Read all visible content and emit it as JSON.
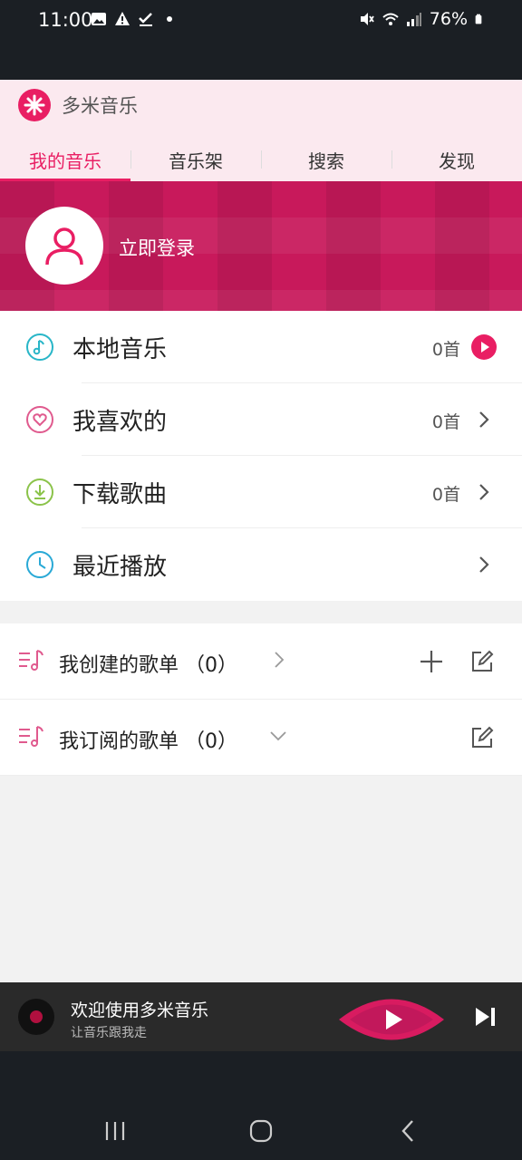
{
  "status": {
    "time": "11:00",
    "battery": "76%"
  },
  "app": {
    "name": "多米音乐"
  },
  "tabs": [
    "我的音乐",
    "音乐架",
    "搜索",
    "发现"
  ],
  "banner": {
    "login": "立即登录"
  },
  "my_music": [
    {
      "label": "本地音乐",
      "count": "0首",
      "action": "play-circle-icon"
    },
    {
      "label": "我喜欢的",
      "count": "0首",
      "action": "chevron-right-icon"
    },
    {
      "label": "下载歌曲",
      "count": "0首",
      "action": "chevron-right-icon"
    },
    {
      "label": "最近播放",
      "count": "",
      "action": "chevron-right-icon"
    }
  ],
  "playlists": [
    {
      "label": "我创建的歌单 （0）"
    },
    {
      "label": "我订阅的歌单 （0）"
    }
  ],
  "player": {
    "title": "欢迎使用多米音乐",
    "subtitle": "让音乐跟我走"
  },
  "colors": {
    "accent": "#e91e63",
    "banner": "#c8195b",
    "bar": "#1b1f24"
  }
}
